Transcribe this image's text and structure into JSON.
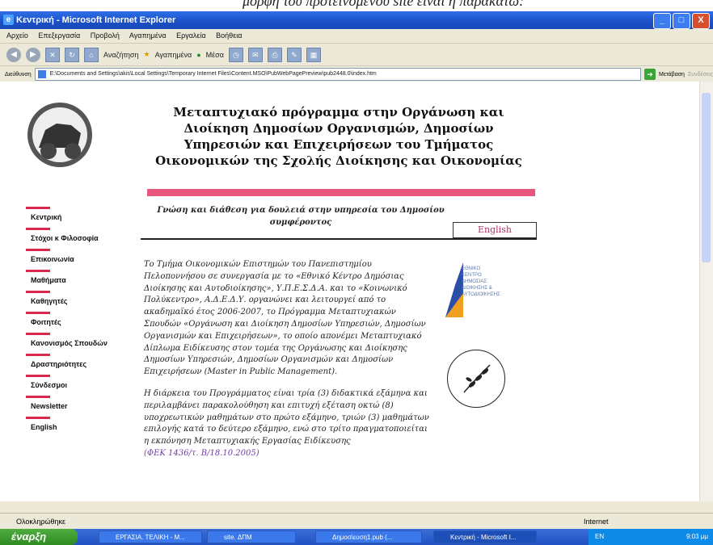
{
  "caption": "μορφή του προτεινόμενου site είναι η παρακάτω:",
  "window": {
    "title": "Κεντρική - Microsoft Internet Explorer",
    "buttons": [
      "_",
      "□",
      "X"
    ]
  },
  "menubar": [
    "Αρχείο",
    "Επεξεργασία",
    "Προβολή",
    "Αγαπημένα",
    "Εργαλεία",
    "Βοήθεια"
  ],
  "toolbar": {
    "search": "Αναζήτηση",
    "favorites": "Αγαπημένα",
    "media": "Μέσα"
  },
  "address": {
    "label": "Διεύθυνση",
    "url": "E:\\Documents and Settings\\akis\\Local Settings\\Temporary Internet Files\\Content.MSO\\PubWebPagePreview\\pub2448.0\\index.htm",
    "go": "Μετάβαση",
    "links": "Συνδέσεις"
  },
  "page": {
    "title": "Μεταπτυχιακό πρόγραμμα στην Οργάνωση και Διοίκηση Δημοσίων Οργανισμών, Δημοσίων Υπηρεσιών και Επιχειρήσεων του Τμήματος Οικονομικών της Σχολής Διοίκησης και Οικονομίας",
    "subtitle": "Γνώση και διάθεση για δουλειά στην υπηρεσία του Δημοσίου συμφέροντος",
    "english_button": "English",
    "nav": [
      "Κεντρική",
      "Στόχοι κ Φιλοσοφία",
      "Επικοινωνία",
      "Μαθήματα",
      "Καθηγητές",
      "Φοιτητές",
      "Κανονισμός Σπουδών",
      "Δραστηριότητες",
      "Σύνδεσμοι",
      "Newsletter",
      "English"
    ],
    "paragraph1": "Το Τμήμα Οικονομικών Επιστημών του Πανεπιστημίου Πελοποννήσου σε συνεργασία με το «Εθνικό Κέντρο Δημόσιας Διοίκησης και Αυτοδιοίκησης», Υ.Π.Ε.Σ.Δ.Α. και το «Κοινωνικό Πολύκεντρο», Α.Δ.Ε.Δ.Υ. οργανώνει και λειτουργεί από το ακαδημαϊκό έτος 2006-2007, το Πρόγραμμα Μεταπτυχιακών Σπουδών «Οργάνωση και Διοίκηση Δημοσίων Υπηρεσιών, Δημοσίων Οργανισμών και Επιχειρήσεων», το οποίο απονέμει Μεταπτυχιακό Δίπλωμα Ειδίκευσης στον τομέα της Οργάνωσης και Διοίκησης Δημοσίων Υπηρεσιών, Δημοσίων Οργανισμών και Δημοσίων Επιχειρήσεων (Master in Public Management).",
    "paragraph2": "Η διάρκεια του Προγράμματος είναι τρία (3) διδακτικά εξάμηνα και περιλαμβάνει παρακολούθηση και επιτυχή εξέταση οκτώ (8) υποχρεωτικών μαθημάτων στο πρώτο εξάμηνο, τριών (3) μαθημάτων επιλογής κατά το δεύτερο εξάμηνο, ενώ στο τρίτο πραγματοποιείται η εκπόνηση Μεταπτυχιακής Εργασίας Ειδίκευσης",
    "reference": "(ΦΕΚ 1436/τ. Β/18.10.2005)",
    "ekdd_logo_text": "ΕΘΝΙΚΟ\nΚΕΝΤΡΟ\nΔΗΜΟΣΙΑΣ\nΔΙΟΙΚΗΣΗΣ &\nΑΥΤΟΔΙΟΙΚΗΣΗΣ"
  },
  "status": {
    "left": "Ολοκληρώθηκε",
    "right": "Internet"
  },
  "taskbar": {
    "start": "έναρξη",
    "tasks": [
      "ΕΡΓΑΣΙΑ. ΤΕΛΙΚΗ - M...",
      "site. ΔΠΜ",
      "Δημοσίευση1.pub (...",
      "Κεντρική - Microsoft I..."
    ],
    "lang": "EN",
    "clock": "9:03 μμ"
  },
  "colors": {
    "accent_pink": "#e8567e",
    "nav_bar": "#d8294f",
    "titlebar": "#1b4fc8"
  }
}
